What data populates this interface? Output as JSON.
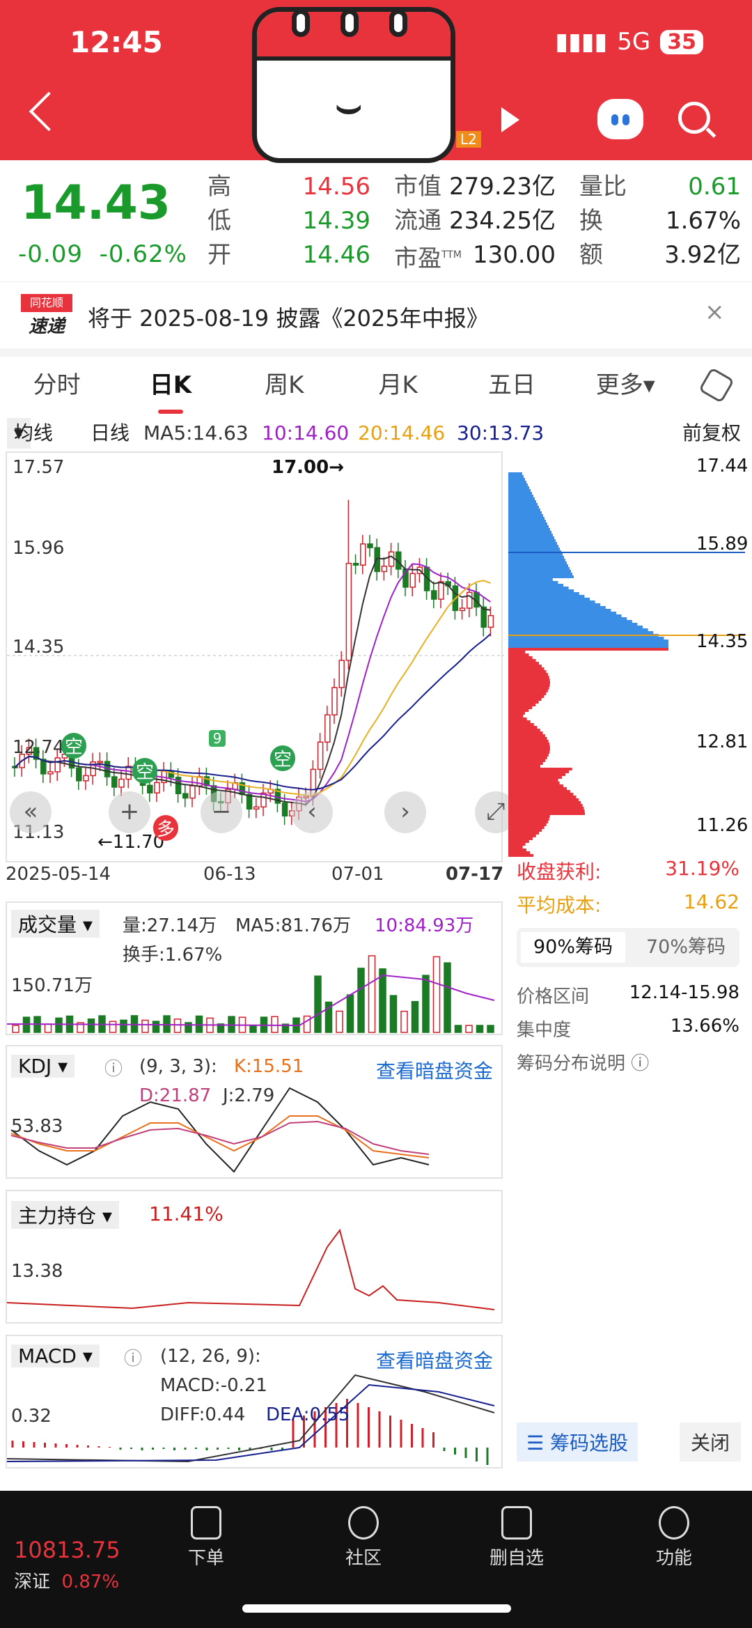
{
  "status": {
    "time": "12:45",
    "network": "5G",
    "battery": "35"
  },
  "header": {
    "badge": "L2"
  },
  "quote": {
    "price": "14.43",
    "change": "-0.09",
    "change_pct": "-0.62%",
    "col1": [
      {
        "label": "高",
        "value": "14.56"
      },
      {
        "label": "低",
        "value": "14.39"
      },
      {
        "label": "开",
        "value": "14.46"
      }
    ],
    "col2": [
      {
        "label": "市值",
        "value": "279.23亿"
      },
      {
        "label": "流通",
        "value": "234.25亿"
      },
      {
        "label": "市盈",
        "sup": "TTM",
        "value": "130.00"
      }
    ],
    "col3": [
      {
        "label": "量比",
        "value": "0.61"
      },
      {
        "label": "换",
        "value": "1.67%"
      },
      {
        "label": "额",
        "value": "3.92亿"
      }
    ]
  },
  "notice": {
    "logo_top": "同花顺",
    "logo_bottom": "速递",
    "text": "将于 2025-08-19 披露《2025年中报》",
    "close": "×"
  },
  "tabs": [
    "分时",
    "日K",
    "周K",
    "月K",
    "五日",
    "更多▾"
  ],
  "ma_bar": {
    "selector": "均线",
    "period": "日线",
    "ma5": "MA5:14.63",
    "ma10": "10:14.60",
    "ma20": "20:14.46",
    "ma30": "30:13.73",
    "adjust": "前复权"
  },
  "kline": {
    "y_labels": [
      "17.57",
      "15.96",
      "14.35",
      "12.74",
      "11.13"
    ],
    "high_marker": "17.00→",
    "low_marker": "←11.70",
    "dates": [
      "2025-05-14",
      "06-13",
      "07-01",
      "07-17"
    ],
    "signals": [
      "空",
      "空",
      "空",
      "多",
      "9"
    ],
    "colors": {
      "up": "#d11f2a",
      "down": "#1b7a24",
      "ma5": "#333333",
      "ma10": "#a020c8",
      "ma20": "#e8b020",
      "ma30": "#141e8c"
    }
  },
  "chips": {
    "labels": [
      "17.44",
      "15.89",
      "14.35",
      "12.81",
      "11.26"
    ],
    "profit_label": "收盘获利:",
    "profit": "31.19%",
    "cost_label": "平均成本:",
    "cost": "14.62",
    "tab90": "90%筹码",
    "tab70": "70%筹码",
    "range_label": "价格区间",
    "range": "12.14-15.98",
    "conc_label": "集中度",
    "conc": "13.66%",
    "explain": "筹码分布说明",
    "select_btn": "筹码选股",
    "close_btn": "关闭"
  },
  "volume": {
    "selector": "成交量",
    "vol": "量:27.14万",
    "ma5": "MA5:81.76万",
    "ma10": "10:84.93万",
    "turnover": "换手:1.67%",
    "ylabel": "150.71万"
  },
  "kdj": {
    "selector": "KDJ",
    "params": "(9, 3, 3):",
    "k": "K:15.51",
    "d": "D:21.87",
    "j": "J:2.79",
    "link": "查看暗盘资金",
    "ylabel": "53.83"
  },
  "main_force": {
    "selector": "主力持仓",
    "value": "11.41%",
    "ylabel": "13.38"
  },
  "macd": {
    "selector": "MACD",
    "params": "(12, 26, 9):",
    "macd": "MACD:-0.21",
    "diff": "DIFF:0.44",
    "dea": "DEA:0.55",
    "link": "查看暗盘资金",
    "ylabel": "0.32"
  },
  "bottom": {
    "index_value": "10813.75",
    "index_name": "深证",
    "index_pct": "0.87%",
    "nav": [
      "下单",
      "社区",
      "删自选",
      "功能"
    ]
  }
}
